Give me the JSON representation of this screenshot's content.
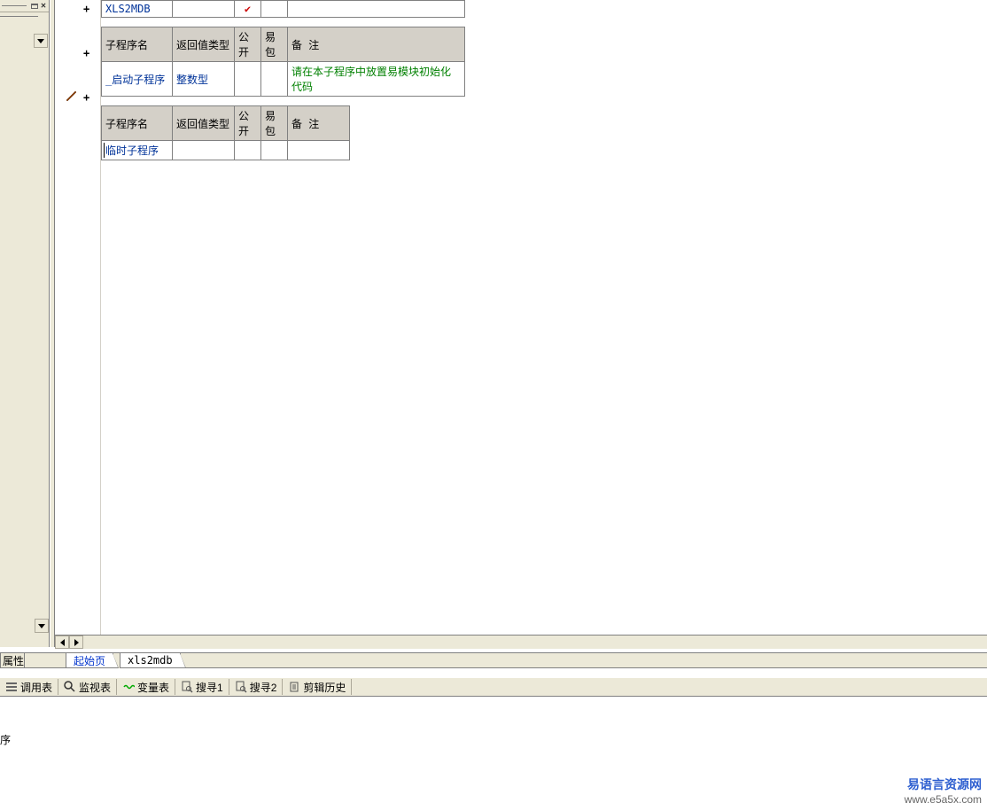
{
  "table0": {
    "row": {
      "name": "XLS2MDB",
      "rettype": "",
      "pub_check": "✔",
      "pkg": "",
      "remark": ""
    }
  },
  "headers": {
    "name": "子程序名",
    "rettype": "返回值类型",
    "pub": "公开",
    "pkg": "易包",
    "remark": "备 注"
  },
  "table1": {
    "row": {
      "name": "_启动子程序",
      "rettype": "整数型",
      "pub": "",
      "pkg": "",
      "remark": "请在本子程序中放置易模块初始化代码"
    }
  },
  "table2": {
    "row": {
      "name": "临时子程序",
      "rettype": "",
      "pub": "",
      "pkg": "",
      "remark": ""
    }
  },
  "tabs1": {
    "left": "属性",
    "t1": "起始页",
    "t2": "xls2mdb"
  },
  "toolbar": {
    "calltable": "调用表",
    "watch": "监视表",
    "vars": "变量表",
    "search1": "搜寻1",
    "search2": "搜寻2",
    "cliphist": "剪辑历史"
  },
  "status": "序",
  "watermark": {
    "line1": "易语言资源网",
    "line2": "www.e5a5x.com"
  }
}
